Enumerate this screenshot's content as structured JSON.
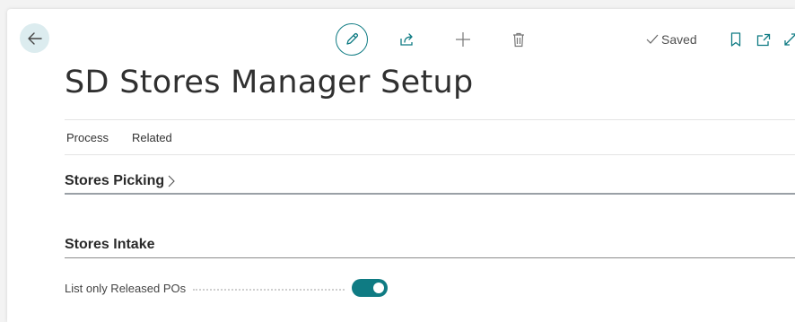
{
  "toolbar": {
    "back_icon": "arrow-left-icon",
    "edit_icon": "pencil-icon",
    "share_icon": "share-icon",
    "new_icon": "plus-icon",
    "delete_icon": "trash-icon",
    "saved_label": "Saved",
    "saved_icon": "checkmark-icon",
    "bookmark_icon": "bookmark-icon",
    "open_new_window_icon": "open-in-new-window-icon",
    "expand_icon": "expand-icon"
  },
  "page": {
    "title": "SD Stores Manager Setup"
  },
  "action_menu": {
    "items": [
      "Process",
      "Related"
    ]
  },
  "sections": [
    {
      "title": "Stores Picking",
      "collapsed": true,
      "icon": "chevron-right-icon"
    },
    {
      "title": "Stores Intake",
      "collapsed": false,
      "fields": [
        {
          "label": "List only Released POs",
          "type": "toggle",
          "value": true
        }
      ]
    }
  ],
  "colors": {
    "accent": "#0f7b83",
    "back_button_bg": "#dcecef",
    "background": "#f3f3f3"
  }
}
